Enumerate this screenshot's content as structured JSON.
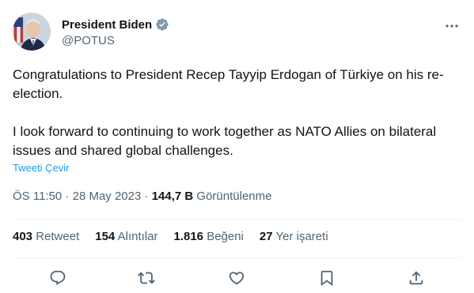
{
  "author": {
    "display_name": "President Biden",
    "handle": "@POTUS",
    "verified_icon": "verified-badge-icon",
    "verified_color": "#829aab"
  },
  "tweet": {
    "paragraphs": [
      "Congratulations to President Recep Tayyip Erdogan of Türkiye on his re-election.",
      "I look forward to continuing to work together as NATO Allies on bilateral issues and shared global challenges."
    ],
    "translate_label": "Tweeti Çevir"
  },
  "meta": {
    "time": "ÖS 11:50",
    "separator": "·",
    "date": "28 May 2023",
    "views_count": "144,7 B",
    "views_label": "Görüntülenme"
  },
  "stats": {
    "retweets": {
      "count": "403",
      "label": "Retweet"
    },
    "quotes": {
      "count": "154",
      "label": "Alıntılar"
    },
    "likes": {
      "count": "1.816",
      "label": "Beğeni"
    },
    "bookmarks": {
      "count": "27",
      "label": "Yer işareti"
    }
  },
  "actions": [
    "reply-icon",
    "retweet-icon",
    "like-icon",
    "bookmark-icon",
    "share-icon"
  ],
  "colors": {
    "text": "#0f1419",
    "secondary": "#536471",
    "link": "#1d9bf0",
    "divider": "#eff3f4"
  }
}
